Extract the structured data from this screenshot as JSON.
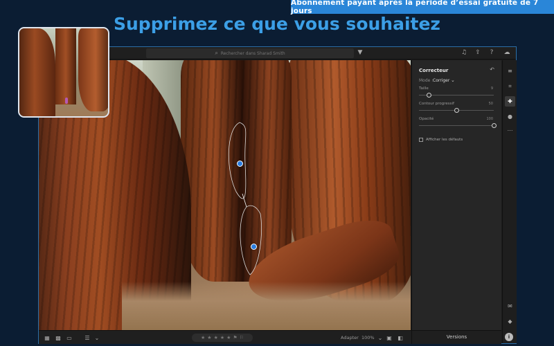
{
  "banner": {
    "text": "Abonnement payant après la période d’essai gratuite de 7 jours"
  },
  "headline": "Supprimez ce que vous souhaitez",
  "topbar": {
    "search_placeholder": "Rechercher dans Sharad Smith",
    "icons": [
      "filter-icon",
      "bell-icon",
      "share-icon",
      "help-icon",
      "cloud-icon"
    ]
  },
  "panel": {
    "title": "Correcteur",
    "mode_label": "Mode :",
    "mode_value": "Corriger",
    "sliders": [
      {
        "label": "Taille",
        "value": "9",
        "fraction": 0.13
      },
      {
        "label": "Contour progressif",
        "value": "50",
        "fraction": 0.5
      },
      {
        "label": "Opacité",
        "value": "100",
        "fraction": 1.0
      }
    ],
    "show_defaults": "Afficher les défauts"
  },
  "bottombar": {
    "fit": "Adapter",
    "zoom": "100%",
    "stars": [
      "★",
      "★",
      "★",
      "★",
      "★"
    ],
    "versions": "Versions"
  },
  "tools": [
    "edit-sliders-icon",
    "crop-icon",
    "healing-icon",
    "mask-icon",
    "more-icon",
    "comment-icon",
    "tag-icon"
  ]
}
